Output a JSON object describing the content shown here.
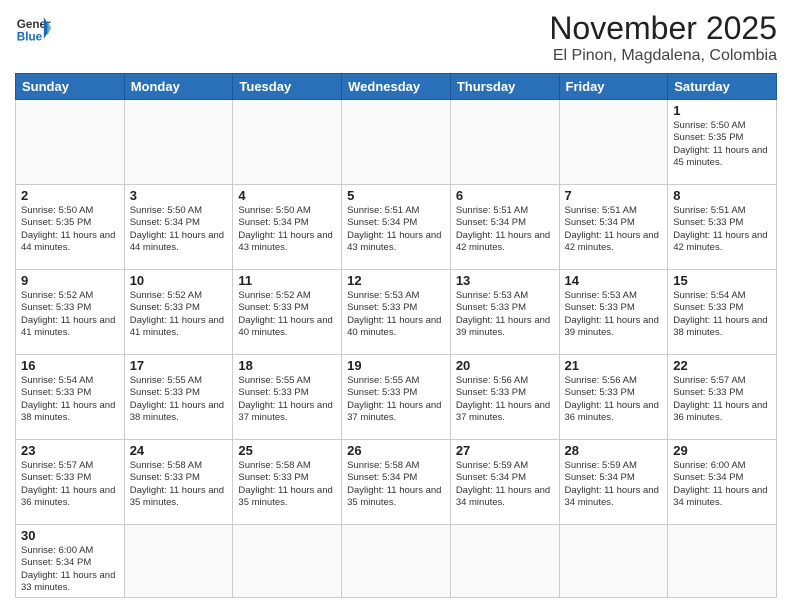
{
  "header": {
    "logo_line1": "General",
    "logo_line2": "Blue",
    "title": "November 2025",
    "subtitle": "El Pinon, Magdalena, Colombia"
  },
  "weekdays": [
    "Sunday",
    "Monday",
    "Tuesday",
    "Wednesday",
    "Thursday",
    "Friday",
    "Saturday"
  ],
  "days": [
    {
      "date": null
    },
    {
      "date": null
    },
    {
      "date": null
    },
    {
      "date": null
    },
    {
      "date": null
    },
    {
      "date": null
    },
    {
      "date": 1,
      "sunrise": "5:50 AM",
      "sunset": "5:35 PM",
      "daylight": "11 hours and 45 minutes."
    },
    {
      "date": 2,
      "sunrise": "5:50 AM",
      "sunset": "5:35 PM",
      "daylight": "11 hours and 44 minutes."
    },
    {
      "date": 3,
      "sunrise": "5:50 AM",
      "sunset": "5:34 PM",
      "daylight": "11 hours and 44 minutes."
    },
    {
      "date": 4,
      "sunrise": "5:50 AM",
      "sunset": "5:34 PM",
      "daylight": "11 hours and 43 minutes."
    },
    {
      "date": 5,
      "sunrise": "5:51 AM",
      "sunset": "5:34 PM",
      "daylight": "11 hours and 43 minutes."
    },
    {
      "date": 6,
      "sunrise": "5:51 AM",
      "sunset": "5:34 PM",
      "daylight": "11 hours and 42 minutes."
    },
    {
      "date": 7,
      "sunrise": "5:51 AM",
      "sunset": "5:34 PM",
      "daylight": "11 hours and 42 minutes."
    },
    {
      "date": 8,
      "sunrise": "5:51 AM",
      "sunset": "5:33 PM",
      "daylight": "11 hours and 42 minutes."
    },
    {
      "date": 9,
      "sunrise": "5:52 AM",
      "sunset": "5:33 PM",
      "daylight": "11 hours and 41 minutes."
    },
    {
      "date": 10,
      "sunrise": "5:52 AM",
      "sunset": "5:33 PM",
      "daylight": "11 hours and 41 minutes."
    },
    {
      "date": 11,
      "sunrise": "5:52 AM",
      "sunset": "5:33 PM",
      "daylight": "11 hours and 40 minutes."
    },
    {
      "date": 12,
      "sunrise": "5:53 AM",
      "sunset": "5:33 PM",
      "daylight": "11 hours and 40 minutes."
    },
    {
      "date": 13,
      "sunrise": "5:53 AM",
      "sunset": "5:33 PM",
      "daylight": "11 hours and 39 minutes."
    },
    {
      "date": 14,
      "sunrise": "5:53 AM",
      "sunset": "5:33 PM",
      "daylight": "11 hours and 39 minutes."
    },
    {
      "date": 15,
      "sunrise": "5:54 AM",
      "sunset": "5:33 PM",
      "daylight": "11 hours and 38 minutes."
    },
    {
      "date": 16,
      "sunrise": "5:54 AM",
      "sunset": "5:33 PM",
      "daylight": "11 hours and 38 minutes."
    },
    {
      "date": 17,
      "sunrise": "5:55 AM",
      "sunset": "5:33 PM",
      "daylight": "11 hours and 38 minutes."
    },
    {
      "date": 18,
      "sunrise": "5:55 AM",
      "sunset": "5:33 PM",
      "daylight": "11 hours and 37 minutes."
    },
    {
      "date": 19,
      "sunrise": "5:55 AM",
      "sunset": "5:33 PM",
      "daylight": "11 hours and 37 minutes."
    },
    {
      "date": 20,
      "sunrise": "5:56 AM",
      "sunset": "5:33 PM",
      "daylight": "11 hours and 37 minutes."
    },
    {
      "date": 21,
      "sunrise": "5:56 AM",
      "sunset": "5:33 PM",
      "daylight": "11 hours and 36 minutes."
    },
    {
      "date": 22,
      "sunrise": "5:57 AM",
      "sunset": "5:33 PM",
      "daylight": "11 hours and 36 minutes."
    },
    {
      "date": 23,
      "sunrise": "5:57 AM",
      "sunset": "5:33 PM",
      "daylight": "11 hours and 36 minutes."
    },
    {
      "date": 24,
      "sunrise": "5:58 AM",
      "sunset": "5:33 PM",
      "daylight": "11 hours and 35 minutes."
    },
    {
      "date": 25,
      "sunrise": "5:58 AM",
      "sunset": "5:33 PM",
      "daylight": "11 hours and 35 minutes."
    },
    {
      "date": 26,
      "sunrise": "5:58 AM",
      "sunset": "5:34 PM",
      "daylight": "11 hours and 35 minutes."
    },
    {
      "date": 27,
      "sunrise": "5:59 AM",
      "sunset": "5:34 PM",
      "daylight": "11 hours and 34 minutes."
    },
    {
      "date": 28,
      "sunrise": "5:59 AM",
      "sunset": "5:34 PM",
      "daylight": "11 hours and 34 minutes."
    },
    {
      "date": 29,
      "sunrise": "6:00 AM",
      "sunset": "5:34 PM",
      "daylight": "11 hours and 34 minutes."
    },
    {
      "date": 30,
      "sunrise": "6:00 AM",
      "sunset": "5:34 PM",
      "daylight": "11 hours and 33 minutes."
    }
  ]
}
